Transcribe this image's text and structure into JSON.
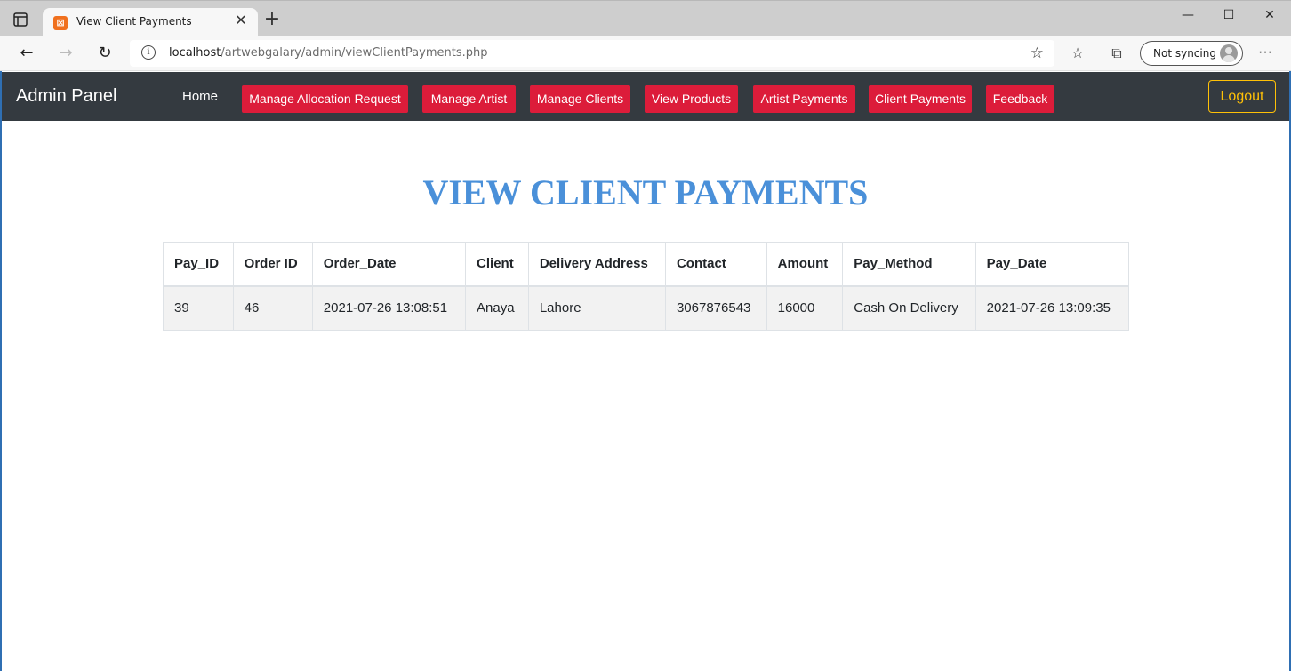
{
  "browser": {
    "tab_title": "View Client Payments",
    "url_host": "localhost",
    "url_path": "/artwebgalary/admin/viewClientPayments.php",
    "sync_label": "Not syncing"
  },
  "navbar": {
    "brand": "Admin Panel",
    "home": "Home",
    "buttons": [
      "Manage Allocation Request",
      "Manage Artist",
      "Manage Clients",
      "View Products",
      "Artist Payments",
      "Client Payments",
      "Feedback"
    ],
    "logout": "Logout",
    "accent_red": "#dc1c3a",
    "accent_yellow": "#ffc107"
  },
  "page": {
    "title": "VIEW CLIENT PAYMENTS",
    "title_color": "#4a90d9"
  },
  "table": {
    "headers": [
      "Pay_ID",
      "Order ID",
      "Order_Date",
      "Client",
      "Delivery Address",
      "Contact",
      "Amount",
      "Pay_Method",
      "Pay_Date"
    ],
    "rows": [
      [
        "39",
        "46",
        "2021-07-26 13:08:51",
        "Anaya",
        "Lahore",
        "3067876543",
        "16000",
        "Cash On Delivery",
        "2021-07-26 13:09:35"
      ]
    ]
  }
}
